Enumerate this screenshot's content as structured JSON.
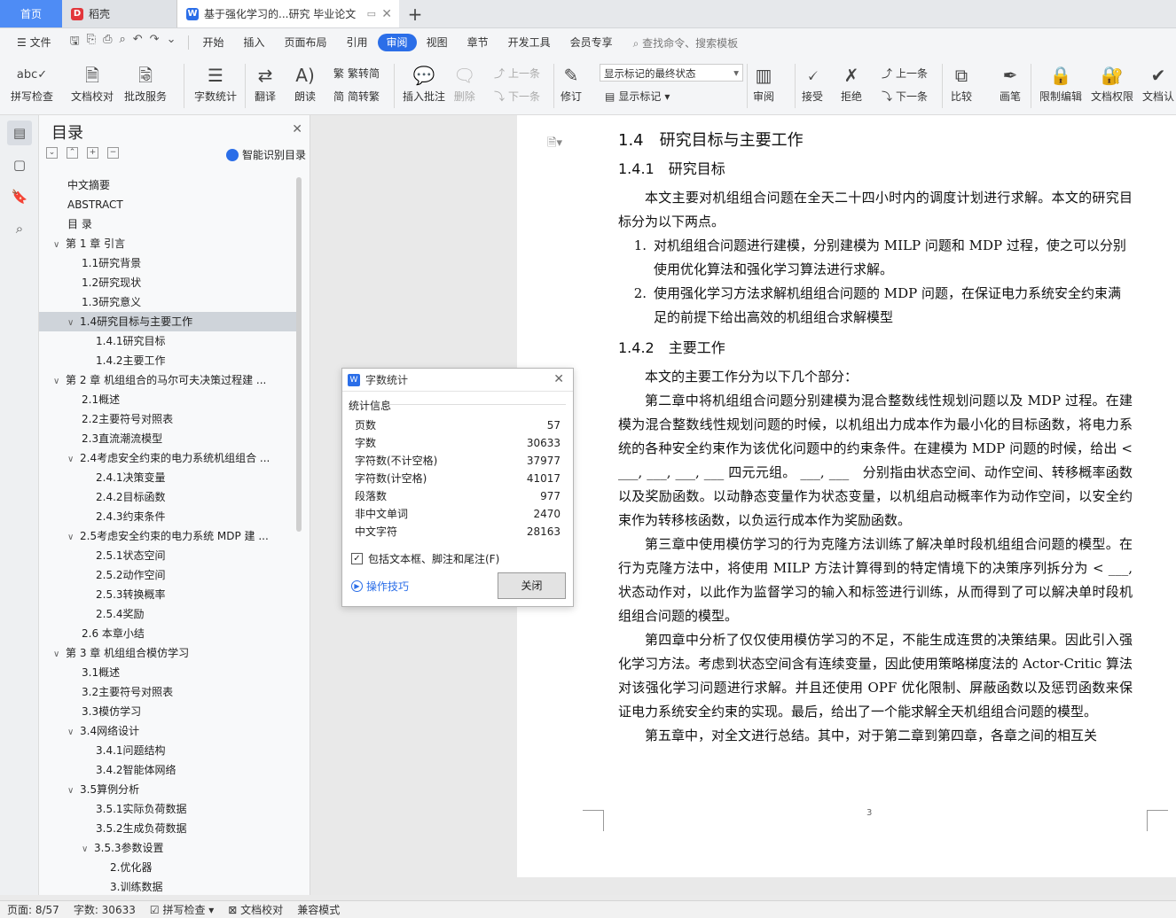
{
  "tabs": {
    "home": "首页",
    "daoke": "稻壳",
    "doc": "基于强化学习的...研究 毕业论文",
    "add": "+"
  },
  "menu": {
    "file": "文件",
    "items": [
      "开始",
      "插入",
      "页面布局",
      "引用",
      "审阅",
      "视图",
      "章节",
      "开发工具",
      "会员专享"
    ],
    "active": "审阅",
    "search": "查找命令、搜索模板"
  },
  "ribbon": {
    "spell": "拼写检查",
    "proof": "文档校对",
    "annotate_service": "批改服务",
    "word_count": "字数统计",
    "translate": "翻译",
    "read_aloud": "朗读",
    "trad": "繁转简",
    "simp": "简转繁",
    "insert_comment": "插入批注",
    "delete": "删除",
    "prev_comment": "上一条",
    "next_comment": "下一条",
    "revise": "修订",
    "markup_combo": "显示标记的最终状态",
    "show_markup": "显示标记",
    "review": "审阅",
    "accept": "接受",
    "reject": "拒绝",
    "prev": "上一条",
    "next": "下一条",
    "compare": "比较",
    "pen": "画笔",
    "restrict": "限制编辑",
    "rights": "文档权限",
    "certify": "文档认"
  },
  "toc": {
    "title": "目录",
    "smart": "智能识别目录",
    "items": [
      {
        "label": "中文摘要",
        "level": 1,
        "arrow": ""
      },
      {
        "label": "ABSTRACT",
        "level": 1,
        "arrow": ""
      },
      {
        "label": "目 录",
        "level": 1,
        "arrow": ""
      },
      {
        "label": "第 1 章 引言",
        "level": 1,
        "arrow": "∨"
      },
      {
        "label": "1.1研究背景",
        "level": 2,
        "arrow": ""
      },
      {
        "label": "1.2研究现状",
        "level": 2,
        "arrow": ""
      },
      {
        "label": "1.3研究意义",
        "level": 2,
        "arrow": ""
      },
      {
        "label": "1.4研究目标与主要工作",
        "level": 2,
        "arrow": "∨",
        "selected": true
      },
      {
        "label": "1.4.1研究目标",
        "level": 3,
        "arrow": ""
      },
      {
        "label": "1.4.2主要工作",
        "level": 3,
        "arrow": ""
      },
      {
        "label": "第 2 章 机组组合的马尔可夫决策过程建 ...",
        "level": 1,
        "arrow": "∨"
      },
      {
        "label": "2.1概述",
        "level": 2,
        "arrow": ""
      },
      {
        "label": "2.2主要符号对照表",
        "level": 2,
        "arrow": ""
      },
      {
        "label": "2.3直流潮流模型",
        "level": 2,
        "arrow": ""
      },
      {
        "label": "2.4考虑安全约束的电力系统机组组合 ...",
        "level": 2,
        "arrow": "∨"
      },
      {
        "label": "2.4.1决策变量",
        "level": 3,
        "arrow": ""
      },
      {
        "label": "2.4.2目标函数",
        "level": 3,
        "arrow": ""
      },
      {
        "label": "2.4.3约束条件",
        "level": 3,
        "arrow": ""
      },
      {
        "label": "2.5考虑安全约束的电力系统 MDP 建 ...",
        "level": 2,
        "arrow": "∨"
      },
      {
        "label": "2.5.1状态空间",
        "level": 3,
        "arrow": ""
      },
      {
        "label": "2.5.2动作空间",
        "level": 3,
        "arrow": ""
      },
      {
        "label": "2.5.3转换概率",
        "level": 3,
        "arrow": ""
      },
      {
        "label": "2.5.4奖励",
        "level": 3,
        "arrow": ""
      },
      {
        "label": "2.6 本章小结",
        "level": 2,
        "arrow": ""
      },
      {
        "label": "第 3 章 机组组合模仿学习",
        "level": 1,
        "arrow": "∨"
      },
      {
        "label": "3.1概述",
        "level": 2,
        "arrow": ""
      },
      {
        "label": "3.2主要符号对照表",
        "level": 2,
        "arrow": ""
      },
      {
        "label": "3.3模仿学习",
        "level": 2,
        "arrow": ""
      },
      {
        "label": "3.4网络设计",
        "level": 2,
        "arrow": "∨"
      },
      {
        "label": "3.4.1问题结构",
        "level": 3,
        "arrow": ""
      },
      {
        "label": "3.4.2智能体网络",
        "level": 3,
        "arrow": ""
      },
      {
        "label": "3.5算例分析",
        "level": 2,
        "arrow": "∨"
      },
      {
        "label": "3.5.1实际负荷数据",
        "level": 3,
        "arrow": ""
      },
      {
        "label": "3.5.2生成负荷数据",
        "level": 3,
        "arrow": ""
      },
      {
        "label": "3.5.3参数设置",
        "level": 3,
        "arrow": "∨"
      },
      {
        "label": "2.优化器",
        "level": 4,
        "arrow": ""
      },
      {
        "label": "3.训练数据",
        "level": 4,
        "arrow": ""
      }
    ]
  },
  "document": {
    "h_1_4": "1.4　研究目标与主要工作",
    "h_1_4_1": "1.4.1　研究目标",
    "p1": "本文主要对机组组合问题在全天二十四小时内的调度计划进行求解。本文的研究目标分为以下两点。",
    "li1_n": "1.",
    "li1": "对机组组合问题进行建模，分别建模为 MILP 问题和 MDP 过程，使之可以分别使用优化算法和强化学习算法进行求解。",
    "li2_n": "2.",
    "li2": "使用强化学习方法求解机组组合问题的 MDP 问题，在保证电力系统安全约束满足的前提下给出高效的机组组合求解模型",
    "h_1_4_2": "1.4.2　主要工作",
    "p2": "本文的主要工作分为以下几个部分：",
    "p3": "第二章中将机组组合问题分别建模为混合整数线性规划问题以及 MDP 过程。在建模为混合整数线性规划问题的时候，以机组出力成本作为最小化的目标函数，将电力系统的各种安全约束作为该优化问题中的约束条件。在建模为 MDP 问题的时候，给出 < ___, ___, ___, ___ 四元元组。 ___, ___　分别指由状态空间、动作空间、转移概率函数以及奖励函数。以动静态变量作为状态变量，以机组启动概率作为动作空间，以安全约束作为转移核函数，以负运行成本作为奖励函数。",
    "p4": "第三章中使用模仿学习的行为克隆方法训练了解决单时段机组组合问题的模型。在行为克隆方法中，将使用 MILP 方法计算得到的特定情境下的决策序列拆分为 < ___,　状态动作对，以此作为监督学习的输入和标签进行训练，从而得到了可以解决单时段机组组合问题的模型。",
    "p5": "第四章中分析了仅仅使用模仿学习的不足，不能生成连贯的决策结果。因此引入强化学习方法。考虑到状态空间含有连续变量，因此使用策略梯度法的 Actor-Critic 算法对该强化学习问题进行求解。并且还使用 OPF 优化限制、屏蔽函数以及惩罚函数来保证电力系统安全约束的实现。最后，给出了一个能求解全天机组组合问题的模型。",
    "p6": "第五章中，对全文进行总结。其中，对于第二章到第四章，各章之间的相互关",
    "page_number": "3"
  },
  "dialog": {
    "title": "字数统计",
    "section": "统计信息",
    "rows": [
      {
        "label": "页数",
        "value": "57"
      },
      {
        "label": "字数",
        "value": "30633"
      },
      {
        "label": "字符数(不计空格)",
        "value": "37977"
      },
      {
        "label": "字符数(计空格)",
        "value": "41017"
      },
      {
        "label": "段落数",
        "value": "977"
      },
      {
        "label": "非中文单词",
        "value": "2470"
      },
      {
        "label": "中文字符",
        "value": "28163"
      }
    ],
    "checkbox": "包括文本框、脚注和尾注(F)",
    "tips": "操作技巧",
    "close": "关闭"
  },
  "status": {
    "page": "页面: 8/57",
    "words": "字数: 30633",
    "spell": "拼写检查",
    "proof": "文档校对",
    "compat": "兼容模式"
  }
}
